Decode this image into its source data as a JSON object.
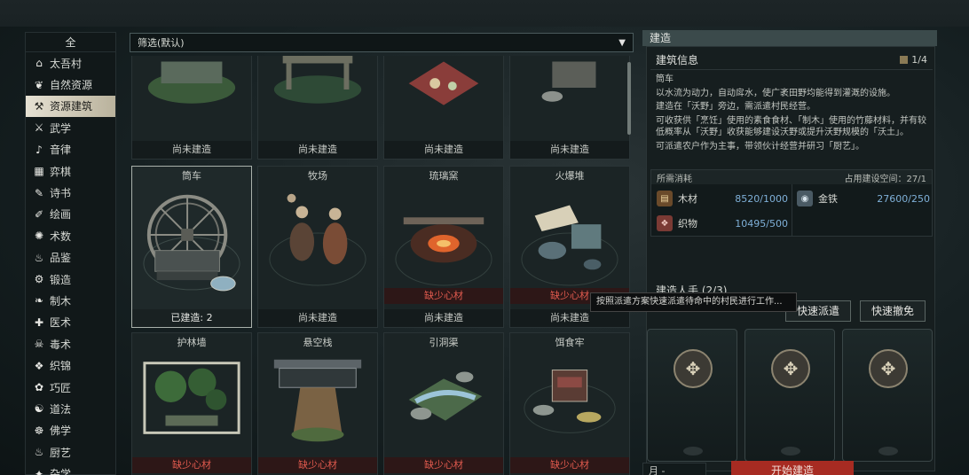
{
  "sidebar": {
    "all_label": "全",
    "items": [
      {
        "label": "太吾村",
        "icon": "village-icon",
        "glyph": "⌂",
        "active": false
      },
      {
        "label": "自然资源",
        "icon": "leaf-icon",
        "glyph": "❦",
        "active": false
      },
      {
        "label": "资源建筑",
        "icon": "hammer-icon",
        "glyph": "⚒",
        "active": true
      },
      {
        "label": "武学",
        "icon": "sword-icon",
        "glyph": "⚔",
        "active": false
      },
      {
        "label": "音律",
        "icon": "music-icon",
        "glyph": "♪",
        "active": false
      },
      {
        "label": "弈棋",
        "icon": "chess-icon",
        "glyph": "▦",
        "active": false
      },
      {
        "label": "诗书",
        "icon": "book-icon",
        "glyph": "✎",
        "active": false
      },
      {
        "label": "绘画",
        "icon": "brush-icon",
        "glyph": "✐",
        "active": false
      },
      {
        "label": "术数",
        "icon": "abacus-icon",
        "glyph": "✺",
        "active": false
      },
      {
        "label": "品鉴",
        "icon": "cup-icon",
        "glyph": "♨",
        "active": false
      },
      {
        "label": "锻造",
        "icon": "anvil-icon",
        "glyph": "⚙",
        "active": false
      },
      {
        "label": "制木",
        "icon": "wood-icon",
        "glyph": "❧",
        "active": false
      },
      {
        "label": "医术",
        "icon": "medicine-icon",
        "glyph": "✚",
        "active": false
      },
      {
        "label": "毒术",
        "icon": "skull-icon",
        "glyph": "☠",
        "active": false
      },
      {
        "label": "织锦",
        "icon": "fabric-icon",
        "glyph": "❖",
        "active": false
      },
      {
        "label": "巧匠",
        "icon": "gear-icon",
        "glyph": "✿",
        "active": false
      },
      {
        "label": "道法",
        "icon": "taiji-icon",
        "glyph": "☯",
        "active": false
      },
      {
        "label": "佛学",
        "icon": "buddha-icon",
        "glyph": "☸",
        "active": false
      },
      {
        "label": "厨艺",
        "icon": "pot-icon",
        "glyph": "♨",
        "active": false
      },
      {
        "label": "杂学",
        "icon": "misc-icon",
        "glyph": "✦",
        "active": false
      }
    ]
  },
  "filter": {
    "label": "筛选(默认)"
  },
  "grid": {
    "row0": [
      {
        "status": "尚未建造"
      },
      {
        "status": "尚未建造"
      },
      {
        "status": "尚未建造"
      },
      {
        "status": "尚未建造"
      }
    ],
    "row1": [
      {
        "name": "筒车",
        "status": "已建造: 2",
        "missing": ""
      },
      {
        "name": "牧场",
        "status": "尚未建造",
        "missing": ""
      },
      {
        "name": "琉璃窯",
        "status": "尚未建造",
        "missing": "缺少心材"
      },
      {
        "name": "火爆堆",
        "status": "尚未建造",
        "missing": "缺少心材"
      }
    ],
    "row2": [
      {
        "name": "护林墙",
        "missing": "缺少心材"
      },
      {
        "name": "悬空栈",
        "missing": "缺少心材"
      },
      {
        "name": "引洞渠",
        "missing": "缺少心材"
      },
      {
        "name": "饵食牢",
        "missing": "缺少心材"
      }
    ]
  },
  "panel": {
    "tab": "建造",
    "info_title": "建筑信息",
    "page": "1/4",
    "building_name": "筒车",
    "desc1": "以水流为动力，自动戽水，使广袤田野均能得到灌溉的设施。",
    "desc2": "建造在「沃野」旁边，需派遣村民经营。",
    "desc3": "可收获供「烹饪」使用的素食食材、「制木」使用的竹藤材料，并有较低概率从「沃野」收获能够建设沃野或提升沃野规模的「沃土」。",
    "desc4": "可派遣农户作为主事，带领伙计经营并研习「厨艺」。",
    "cost_label": "所需消耗",
    "space_label": "占用建设空间：27/1",
    "resources": [
      {
        "name": "木材",
        "value": "8520/1000",
        "icon": "wood-resource-icon"
      },
      {
        "name": "金铁",
        "value": "27600/250",
        "icon": "metal-resource-icon"
      },
      {
        "name": "织物",
        "value": "10495/500",
        "icon": "fabric-resource-icon"
      }
    ],
    "workers_title": "建造人手 (2/3)",
    "quick_assign": "快速派遣",
    "quick_dismiss": "快速撤免",
    "tooltip": "按照派遣方案快速派遣待命中的村民进行工作...",
    "start_button": "开始建造",
    "month_label": "月 -"
  },
  "colors": {
    "accent_red": "#a72b22",
    "missing_red": "#e05a4e",
    "value_blue": "#7fb0d8"
  }
}
